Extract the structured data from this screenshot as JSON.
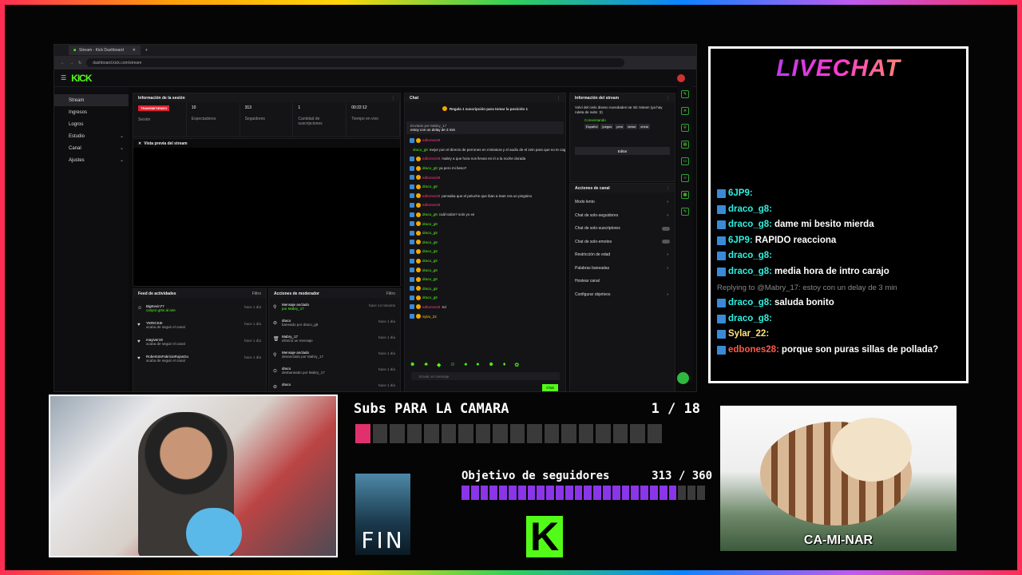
{
  "browser": {
    "tab_title": "Stream - Kick Dashboard",
    "url": "dashboard.kick.com/stream"
  },
  "kick": {
    "logo": "KICK"
  },
  "sidebar": {
    "items": [
      {
        "label": "Stream"
      },
      {
        "label": "Ingresos"
      },
      {
        "label": "Logros"
      },
      {
        "label": "Estudio"
      },
      {
        "label": "Canal"
      },
      {
        "label": "Ajustes"
      }
    ]
  },
  "session": {
    "title": "Información de la sesión",
    "status": "TRANSMITIENDO",
    "status_label": "Sesión",
    "stats": [
      {
        "value": "10",
        "label": "Espectadores"
      },
      {
        "value": "313",
        "label": "Seguidores"
      },
      {
        "value": "1",
        "label": "Cantidad de suscripciones"
      },
      {
        "value": "00:22:12",
        "label": "Tiempo en vivo"
      }
    ]
  },
  "preview": {
    "title": "Vista previa del stream"
  },
  "feed": {
    "title": "Feed de actividades",
    "filter": "Filtro",
    "items": [
      {
        "name": "BigKevin77",
        "sub": "canjeó grito al aire",
        "time": "hace 1 día"
      },
      {
        "name": "YERICKIII",
        "sub": "acaba de seguir el canal",
        "time": "hace 1 día"
      },
      {
        "name": "mayiver19",
        "sub": "acaba de seguir el canal",
        "time": "hace 1 día"
      },
      {
        "name": "RobertoIsFabricioRojasGu",
        "sub": "acaba de seguir el canal",
        "time": "hace 1 día"
      }
    ]
  },
  "mod": {
    "title": "Acciones de moderador",
    "filter": "Filtro",
    "items": [
      {
        "name": "Mensaje anclado",
        "sub": "por Mabry_17",
        "time": "hace 14 minutos"
      },
      {
        "name": "draco",
        "sub": "baneado por draco_g8",
        "time": "hace 1 día"
      },
      {
        "name": "Mabry_17",
        "sub": "eliminó un mensaje",
        "time": "hace 1 día"
      },
      {
        "name": "Mensaje anclado",
        "sub": "desanclado por Mabry_17",
        "time": "hace 1 día"
      },
      {
        "name": "draco",
        "sub": "desbaneado por Mabry_17",
        "time": "hace 1 día"
      },
      {
        "name": "draco",
        "sub": "",
        "time": "hace 1 día"
      }
    ]
  },
  "chat": {
    "title": "Chat",
    "gift": "Regala 1 suscripción para tomar la posición 1",
    "pinned_by": "Enviado por Mabry_17",
    "pinned": "estoy con un delay de 3 min",
    "placeholder": "Enviar un mensaje",
    "send": "Chat",
    "lines": [
      {
        "user": "edbones28",
        "text": ""
      },
      {
        "user": "draco_g8",
        "text": "mejor pon el directo de perrones en miniatura y el audio de el zein para que no te caguen"
      },
      {
        "user": "edbones28",
        "text": "mabry a que hora nos llevas en iri a la noche dorada"
      },
      {
        "user": "draco_g8",
        "text": "ya pero mi beso?"
      },
      {
        "user": "edbones28",
        "text": ""
      },
      {
        "user": "draco_g8",
        "text": ""
      },
      {
        "user": "edbones28",
        "text": "pensaba que el peluche que iban a traer era un pingüino"
      },
      {
        "user": "edbones28",
        "text": ""
      },
      {
        "user": "draco_g8",
        "text": "cuál todos? solo yo xe"
      },
      {
        "user": "draco_g8",
        "text": ""
      },
      {
        "user": "draco_g8",
        "text": ""
      },
      {
        "user": "draco_g8",
        "text": ""
      },
      {
        "user": "draco_g8",
        "text": ""
      },
      {
        "user": "draco_g8",
        "text": ""
      },
      {
        "user": "draco_g8",
        "text": ""
      },
      {
        "user": "draco_g8",
        "text": ""
      },
      {
        "user": "draco_g8",
        "text": ""
      },
      {
        "user": "draco_g8",
        "text": ""
      },
      {
        "user": "edbones28",
        "text": "Xd"
      },
      {
        "user": "Sylar_22",
        "text": ""
      }
    ]
  },
  "stream_info": {
    "title": "Información del stream",
    "desc": "Volví del cielo diseso novedades !ar !dc !steam (ya hay ruleta de subs :3)",
    "category": "Conversando",
    "tags": [
      "Español",
      "juegos",
      "perú",
      "debut",
      "chela"
    ],
    "edit": "Editar"
  },
  "channel": {
    "title": "Acciones de canal",
    "rows": [
      {
        "label": "Modo lento",
        "kind": "arrow"
      },
      {
        "label": "Chat de solo-seguidores",
        "kind": "arrow"
      },
      {
        "label": "Chat de solo-suscriptores",
        "kind": "toggle"
      },
      {
        "label": "Chat de solo-emotes",
        "kind": "toggle"
      },
      {
        "label": "Restricción de edad",
        "kind": "arrow"
      },
      {
        "label": "Palabras baneadas",
        "kind": "arrow"
      },
      {
        "label": "Hostear canal",
        "kind": "none"
      },
      {
        "label": "Configurar objetivos",
        "kind": "arrow"
      }
    ]
  },
  "livechat": {
    "title": "LIVECHAT",
    "messages": [
      {
        "user": "6JP9:",
        "text": "",
        "style": "un"
      },
      {
        "user": "draco_g8:",
        "text": "",
        "style": "un"
      },
      {
        "user": "draco_g8:",
        "text": "dame mi besito mierda",
        "style": "un"
      },
      {
        "user": "6JP9:",
        "text": "RAPIDO reacciona",
        "style": "un"
      },
      {
        "user": "draco_g8:",
        "text": "",
        "style": "un"
      },
      {
        "user": "draco_g8:",
        "text": "media hora de intro carajo",
        "style": "un"
      },
      {
        "user": "",
        "text": "Replying to @Mabry_17: estoy con un delay de 3 min",
        "style": "rep"
      },
      {
        "user": "draco_g8:",
        "text": "saluda bonito",
        "style": "un"
      },
      {
        "user": "draco_g8:",
        "text": "",
        "style": "un"
      },
      {
        "user": "Sylar_22:",
        "text": "",
        "style": "un3"
      },
      {
        "user": "edbones28:",
        "text": "porque son puras sillas de pollada?",
        "style": "un2"
      }
    ]
  },
  "goal_subs": {
    "title": "Subs PARA LA CAMARA",
    "progress": "1 / 18",
    "current": 1,
    "target": 18
  },
  "goal_followers": {
    "title": "Objetivo de seguidores",
    "progress": "313 / 360",
    "current": 313,
    "target": 360
  },
  "fin": {
    "text": "FIN"
  },
  "kick_badge": {
    "letter": "K"
  },
  "furret": {
    "caption": "CA-MI-NAR"
  },
  "colors": {
    "kick_green": "#53fc18",
    "subs_fill": "#e0306e",
    "followers_fill": "#8a35e8"
  }
}
